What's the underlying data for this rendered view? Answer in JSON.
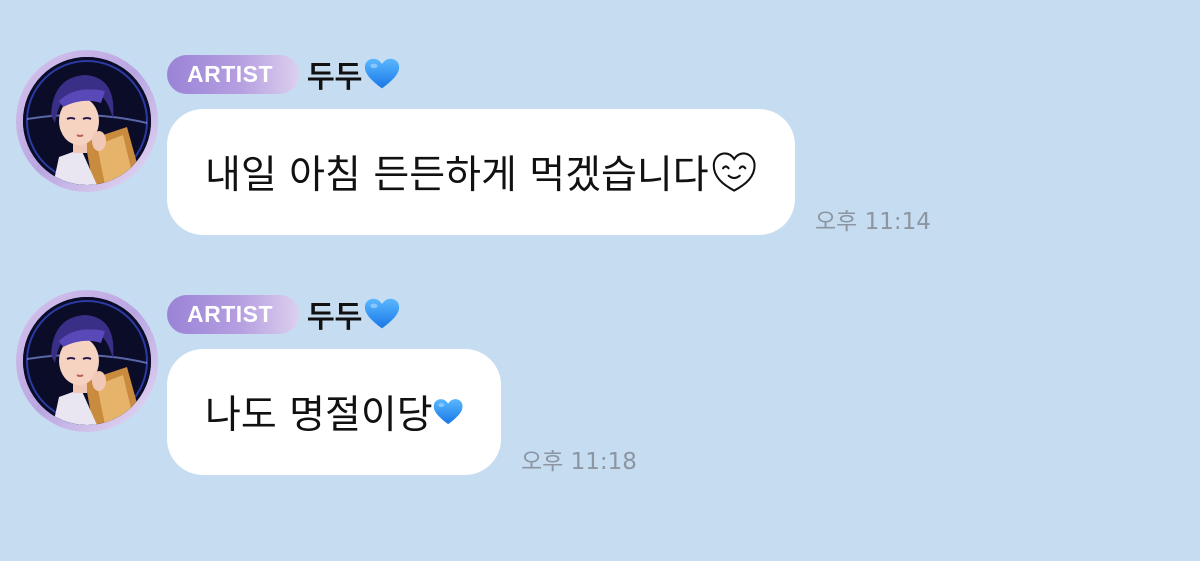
{
  "messages": [
    {
      "badge": "ARTIST",
      "sender": "두두",
      "sender_icon": "blue-heart-icon",
      "text": "내일 아침 든든하게 먹겠습니다",
      "text_icon": "smiling-heart-face-icon",
      "time": "오후 11:14"
    },
    {
      "badge": "ARTIST",
      "sender": "두두",
      "sender_icon": "blue-heart-icon",
      "text": "나도 명절이당",
      "text_icon": "blue-heart-icon",
      "time": "오후 11:18"
    }
  ],
  "colors": {
    "background": "#c6dcf1",
    "bubble": "#ffffff",
    "badge_gradient_start": "#9a83d6",
    "badge_gradient_end": "#dcd0ee",
    "heart": "#1e8cf0",
    "timestamp": "#8c96a2"
  }
}
